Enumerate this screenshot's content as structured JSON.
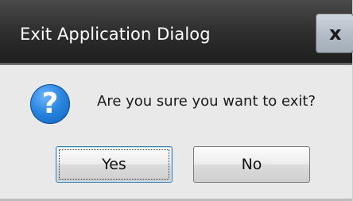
{
  "window": {
    "title": "Exit Application Dialog",
    "close_glyph": "x"
  },
  "message": {
    "icon": "question-icon",
    "icon_glyph": "?",
    "text": "Are you sure you want to exit?"
  },
  "buttons": {
    "yes_label": "Yes",
    "no_label": "No",
    "default": "Yes"
  },
  "colors": {
    "title_bar": "#2b2b2b",
    "dialog_background": "#e9e9e9",
    "icon_blue": "#2a86e0",
    "focus_border": "#3c7fb1"
  }
}
